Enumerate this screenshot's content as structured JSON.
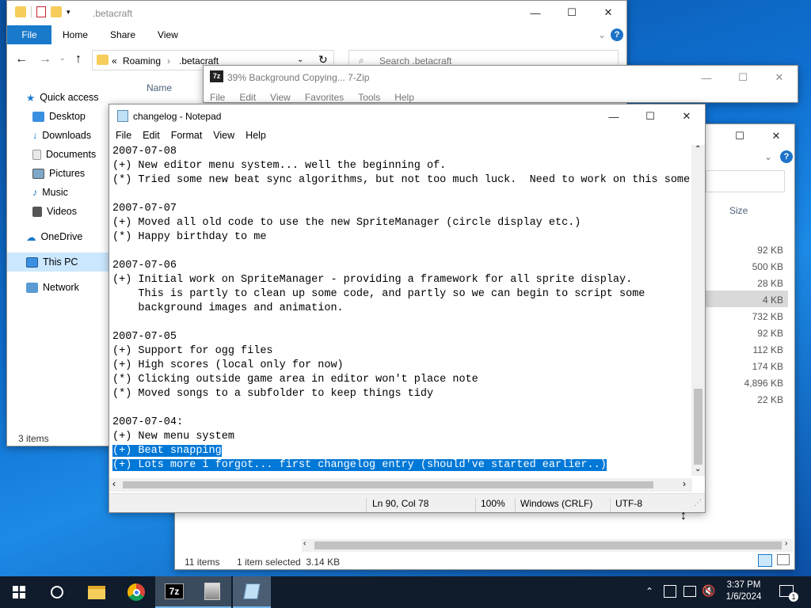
{
  "explorer": {
    "title": ".betacraft",
    "ribbon_tabs": [
      "File",
      "Home",
      "Share",
      "View"
    ],
    "breadcrumb": [
      "«",
      "Roaming",
      "›",
      ".betacraft"
    ],
    "search_placeholder": "Search .betacraft",
    "column_name": "Name",
    "nav": {
      "quick_access": "Quick access",
      "items": [
        "Desktop",
        "Downloads",
        "Documents",
        "Pictures",
        "Music",
        "Videos"
      ],
      "onedrive": "OneDrive",
      "this_pc": "This PC",
      "network": "Network"
    },
    "status": "3 items"
  },
  "zip": {
    "title": "39% Background Copying... 7-Zip",
    "menu": [
      "File",
      "Edit",
      "View",
      "Favorites",
      "Tools",
      "Help"
    ]
  },
  "explorer2": {
    "size_header": "Size",
    "sizes": [
      "92 KB",
      "500 KB",
      "28 KB",
      "4 KB",
      "732 KB",
      "92 KB",
      "112 KB",
      "174 KB",
      "4,896 KB",
      "22 KB"
    ],
    "status_items": "11 items",
    "status_selected": "1 item selected  3.14 KB"
  },
  "notepad": {
    "title": "changelog - Notepad",
    "menu": [
      "File",
      "Edit",
      "Format",
      "View",
      "Help"
    ],
    "lines": [
      "2007-07-08",
      "(+) New editor menu system... well the beginning of.",
      "(*) Tried some new beat sync algorithms, but not too much luck.  Need to work on this some",
      "",
      "2007-07-07",
      "(+) Moved all old code to use the new SpriteManager (circle display etc.)",
      "(*) Happy birthday to me",
      "",
      "2007-07-06",
      "(+) Initial work on SpriteManager - providing a framework for all sprite display.",
      "    This is partly to clean up some code, and partly so we can begin to script some",
      "    background images and animation.",
      "",
      "2007-07-05",
      "(+) Support for ogg files",
      "(+) High scores (local only for now)",
      "(*) Clicking outside game area in editor won't place note",
      "(*) Moved songs to a subfolder to keep things tidy",
      "",
      "2007-07-04:",
      "(+) New menu system"
    ],
    "selected_lines": [
      "(+) Beat snapping",
      "(+) Lots more i forgot... first changelog entry (should've started earlier..)"
    ],
    "status": {
      "position": "Ln 90, Col 78",
      "zoom": "100%",
      "eol": "Windows (CRLF)",
      "encoding": "UTF-8"
    }
  },
  "taskbar": {
    "time": "3:37 PM",
    "date": "1/6/2024",
    "notification_count": "1",
    "zip_label": "7z"
  },
  "colors": {
    "accent": "#0078d7",
    "ribbon_file": "#1979ca",
    "taskbar": "#101c2c",
    "selection": "#cce8ff"
  }
}
